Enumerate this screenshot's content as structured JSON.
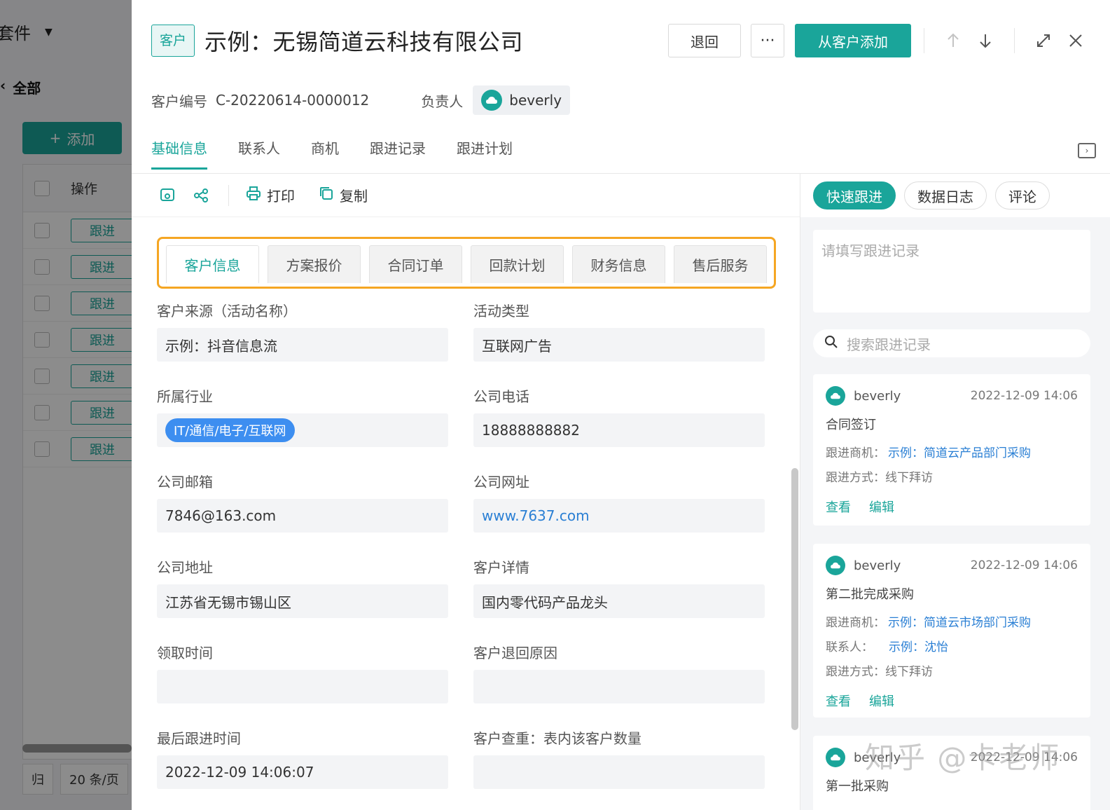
{
  "background": {
    "title": "套件",
    "all_label": "全部",
    "add_button": "添加",
    "column_header": "操作",
    "row_action": "跟进",
    "row_count": 7,
    "footer_prev": "归",
    "page_size": "20 条/页"
  },
  "header": {
    "tag": "客户",
    "title": "示例：无锡简道云科技有限公司",
    "back_button": "退回",
    "more_button": "···",
    "primary_button": "从客户添加"
  },
  "meta": {
    "customer_no_label": "客户编号",
    "customer_no": "C-20220614-0000012",
    "owner_label": "负责人",
    "owner_name": "beverly"
  },
  "main_tabs": [
    "基础信息",
    "联系人",
    "商机",
    "跟进记录",
    "跟进计划"
  ],
  "toolbar": {
    "print": "打印",
    "copy": "复制"
  },
  "sub_tabs": [
    "客户信息",
    "方案报价",
    "合同订单",
    "回款计划",
    "财务信息",
    "售后服务"
  ],
  "form": {
    "source_label": "客户来源（活动名称）",
    "source_value": "示例：抖音信息流",
    "activity_type_label": "活动类型",
    "activity_type_value": "互联网广告",
    "industry_label": "所属行业",
    "industry_value": "IT/通信/电子/互联网",
    "phone_label": "公司电话",
    "phone_value": "18888888882",
    "email_label": "公司邮箱",
    "email_value": "7846@163.com",
    "website_label": "公司网址",
    "website_value": "www.7637.com",
    "address_label": "公司地址",
    "address_value": "江苏省无锡市锡山区",
    "detail_label": "客户详情",
    "detail_value": "国内零代码产品龙头",
    "claim_time_label": "领取时间",
    "claim_time_value": "",
    "return_reason_label": "客户退回原因",
    "return_reason_value": "",
    "last_follow_label": "最后跟进时间",
    "last_follow_value": "2022-12-09 14:06:07",
    "dup_check_label": "客户查重：表内该客户数量",
    "dup_check_value": ""
  },
  "right_panel": {
    "tabs": [
      "快速跟进",
      "数据日志",
      "评论"
    ],
    "note_placeholder": "请填写跟进记录",
    "search_placeholder": "搜索跟进记录",
    "records": [
      {
        "user": "beverly",
        "time": "2022-12-09 14:06",
        "title": "合同签订",
        "opportunity_label": "跟进商机：",
        "opportunity": "示例：简道云产品部门采购",
        "method_label": "跟进方式：",
        "method": "线下拜访",
        "view": "查看",
        "edit": "编辑"
      },
      {
        "user": "beverly",
        "time": "2022-12-09 14:06",
        "title": "第二批完成采购",
        "opportunity_label": "跟进商机：",
        "opportunity": "示例：简道云市场部门采购",
        "contact_label": "联系人：",
        "contact": "示例：沈怡",
        "method_label": "跟进方式：",
        "method": "线下拜访",
        "view": "查看",
        "edit": "编辑"
      },
      {
        "user": "beverly",
        "time": "2022-12-09 14:06",
        "title": "第一批采购"
      }
    ]
  },
  "watermark": "知乎 @卡老师",
  "colors": {
    "accent": "#1aa59a",
    "link": "#2a7fd4",
    "highlight_border": "#f5a623",
    "industry_pill": "#3d8ef0"
  }
}
